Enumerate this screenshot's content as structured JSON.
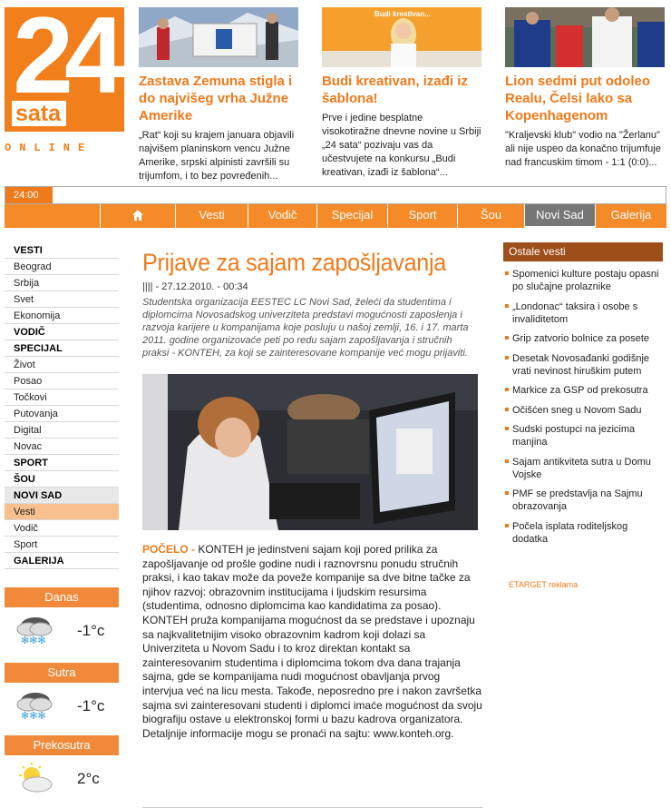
{
  "logo": {
    "number": "24",
    "word": "sata",
    "sub": "ONLINE"
  },
  "teasers": [
    {
      "title": "Zastava Zemuna stigla i do najvišeg vrha Južne Amerike",
      "text": "„Rat“ koji su krajem januara objavili najvišem planinskom vencu Južne Amerike, srpski alpinisti završili su trijumfom, i to bez povređenih..."
    },
    {
      "title": "Budi kreativan, izađi iz šablona!",
      "text": "Prve i jedine besplatne visokotiražne dnevne novine u Srbiji „24 sata“ pozivaju vas da učestvujete na konkursu „Budi kreativan, izađi iz šablona“...",
      "image_caption": "Budi kreativan..."
    },
    {
      "title": "Lion sedmi put odoleo Realu, Čelsi lako sa Kopenhagenom",
      "text": "\"Kraljevski klub\" vodio na \"Žerlanu\" ali nije uspeo da konačno trijumfuje nad francuskim timom - 1:1 (0:0)..."
    }
  ],
  "ticker": {
    "time": "24:00"
  },
  "nav": {
    "home_icon": "home-icon",
    "items": [
      "Vesti",
      "Vodič",
      "Specijal",
      "Sport",
      "Šou",
      "Novi Sad",
      "Galerija"
    ],
    "active": "Novi Sad"
  },
  "sidebar": {
    "items": [
      {
        "label": "VESTI",
        "type": "section"
      },
      {
        "label": "Beograd"
      },
      {
        "label": "Srbija"
      },
      {
        "label": "Svet"
      },
      {
        "label": "Ekonomija"
      },
      {
        "label": "VODIČ",
        "type": "section"
      },
      {
        "label": "SPECIJAL",
        "type": "section"
      },
      {
        "label": "Život"
      },
      {
        "label": "Posao"
      },
      {
        "label": "Točkovi"
      },
      {
        "label": "Putovanja"
      },
      {
        "label": "Digital"
      },
      {
        "label": "Novac"
      },
      {
        "label": "SPORT",
        "type": "section"
      },
      {
        "label": "ŠOU",
        "type": "section"
      },
      {
        "label": "NOVI SAD",
        "type": "section",
        "style": "grey"
      },
      {
        "label": "Vesti",
        "style": "highlight"
      },
      {
        "label": "Vodič"
      },
      {
        "label": "Sport"
      },
      {
        "label": "GALERIJA",
        "type": "section"
      }
    ]
  },
  "weather": [
    {
      "day": "Danas",
      "temp": "-1°c",
      "icon": "snow-cloud-icon"
    },
    {
      "day": "Sutra",
      "temp": "-1°c",
      "icon": "snow-cloud-icon"
    },
    {
      "day": "Prekosutra",
      "temp": "2°c",
      "icon": "sun-cloud-icon"
    }
  ],
  "article": {
    "title": "Prijave za sajam zapošljavanja",
    "date": "|||| - 27.12.2010. - 00:34",
    "lead": "Studentska organizacija EESTEC LC Novi Sad, želeći da studentima i diplomcima Novosadskog univerziteta predstavi mogućnosti zaposlenja i razvoja karijere u kompanijama koje posluju u našoj zemlji, 16. i 17. marta 2011. godine organizovaće peti po redu sajam zapošljavanja i stručnih praksi - KONTEH, za koji se zainteresovane kompanije već mogu prijaviti.",
    "kicker": "POČELO - ",
    "body": "KONTEH je jedinstveni sajam koji pored prilika za zapošljavanje od prošle godine nudi i raznovrsnu ponudu stručnih praksi, i kao takav može da poveže kompanije sa dve bitne tačke za njihov razvoj: obrazovnim institucijama i ljudskim resursima (studentima, odnosno diplomcima kao kandidatima za posao). KONTEH pruža kompanijama mogućnost da se predstave i upoznaju sa najkvalitetnijim visoko obrazovnim kadrom koji dolazi sa Univerziteta u Novom Sadu i to kroz direktan kontakt sa zainteresovanim studentima i diplomcima tokom dva dana trajanja sajma, gde se kompanijama nudi mogućnost obavljanja prvog intervjua već na licu mesta. Takođe, neposredno pre i nakon završetka sajma svi zainteresovani studenti i diplomci imaće mogućnost da svoju biografiju ostave u elektronskoj formi u bazu kadrova organizatora. Detaljnije informacije mogu se pronaći na sajtu: www.konteh.org."
  },
  "right": {
    "header": "Ostale vesti",
    "items": [
      "Spomenici kulture postaju opasni po slučajne prolaznike",
      "„Londonac“ taksira i osobe s invaliditetom",
      "Grip zatvorio bolnice za posete",
      "Desetak Novosađanki godišnje vrati nevinost hiruškim putem",
      "Markice za GSP od prekosutra",
      "Očišćen sneg u Novom Sadu",
      "Sudski postupci na jezicima manjina",
      "Sajam antikviteta sutra u Domu Vojske",
      "PMF se predstavlja na Sajmu obrazovanja",
      "Počela isplata roditeljskog dodatka"
    ],
    "ad": "ETARGET reklama"
  },
  "colors": {
    "accent": "#ee7a1b",
    "nav": "#f48a28",
    "right_header": "#9e4e19",
    "active_nav": "#777777"
  }
}
